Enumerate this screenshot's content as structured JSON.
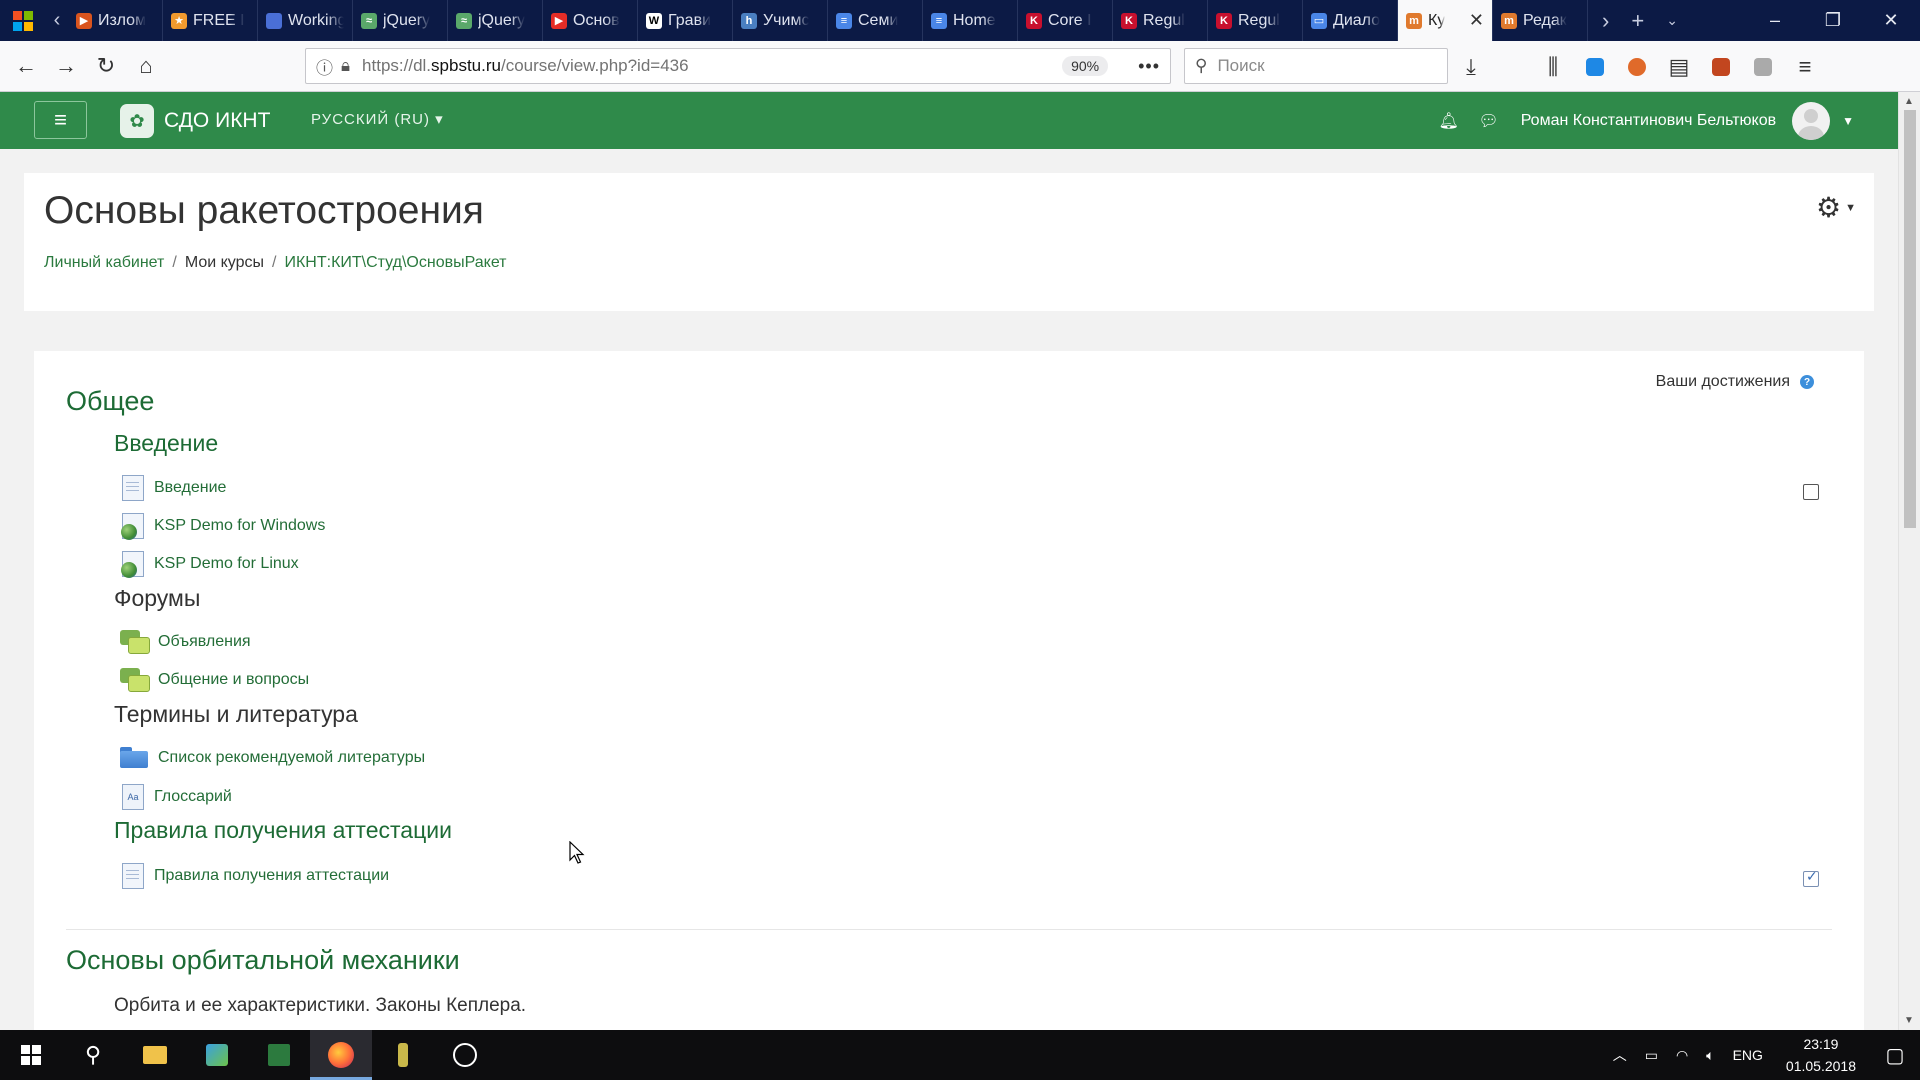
{
  "browser": {
    "tabs": [
      {
        "label": "Излом",
        "color": "#d9541e",
        "glyph": "▶"
      },
      {
        "label": "FREE I",
        "color": "#f29a2e",
        "glyph": "★"
      },
      {
        "label": "Working w",
        "color": "#4a6fd6",
        "glyph": ""
      },
      {
        "label": "jQuery",
        "color": "#5aa86a",
        "glyph": "≈"
      },
      {
        "label": "jQuery",
        "color": "#5aa86a",
        "glyph": "≈"
      },
      {
        "label": "Основ",
        "color": "#e52d27",
        "glyph": "▶"
      },
      {
        "label": "Грави",
        "color": "#ffffff",
        "glyph": "W"
      },
      {
        "label": "Учимс",
        "color": "#4a7fc1",
        "glyph": "h"
      },
      {
        "label": "Семи",
        "color": "#4a86e8",
        "glyph": "≡"
      },
      {
        "label": "Home",
        "color": "#4a86e8",
        "glyph": "≡"
      },
      {
        "label": "Core I",
        "color": "#c8102e",
        "glyph": "K"
      },
      {
        "label": "Regul",
        "color": "#c8102e",
        "glyph": "K"
      },
      {
        "label": "Regul",
        "color": "#c8102e",
        "glyph": "K"
      },
      {
        "label": "Диало",
        "color": "#4a86e8",
        "glyph": "▭"
      },
      {
        "label": "Ку",
        "color": "#e07a2e",
        "glyph": "m",
        "active": true
      },
      {
        "label": "Редак",
        "color": "#e07a2e",
        "glyph": "m"
      }
    ],
    "url_prefix": "https://dl.",
    "url_domain": "spbstu.ru",
    "url_path": "/course/view.php?id=436",
    "zoom": "90%",
    "search_placeholder": "Поиск"
  },
  "navbar": {
    "brand": "СДО ИКНТ",
    "language": "РУССКИЙ (RU)",
    "user_name": "Роман Константинович Бельтюков"
  },
  "header": {
    "title": "Основы ракетостроения",
    "breadcrumb": [
      "Личный кабинет",
      "Мои курсы",
      "ИКНТ:КИТ\\Студ\\ОсновыРакет"
    ]
  },
  "course": {
    "achievements_label": "Ваши достижения",
    "section1_title": "Общее",
    "groups": [
      {
        "title": "Введение",
        "style": "green"
      },
      {
        "title": "Форумы",
        "style": "dark"
      },
      {
        "title": "Термины и литература",
        "style": "dark"
      },
      {
        "title": "Правила получения аттестации",
        "style": "green"
      }
    ],
    "activities": [
      {
        "label": "Введение",
        "icon": "page-icon"
      },
      {
        "label": "KSP Demo for Windows",
        "icon": "url-icon"
      },
      {
        "label": "KSP Demo for Linux",
        "icon": "url-icon"
      },
      {
        "label": "Объявления",
        "icon": "forum-icon"
      },
      {
        "label": "Общение и вопросы",
        "icon": "forum-icon"
      },
      {
        "label": "Список рекомендуемой литературы",
        "icon": "folder-icon"
      },
      {
        "label": "Глоссарий",
        "icon": "glossary-icon"
      },
      {
        "label": "Правила получения аттестации",
        "icon": "page-icon"
      }
    ],
    "section2_title": "Основы орбитальной механики",
    "section2_summary": "Орбита и ее характеристики. Законы Кеплера."
  },
  "taskbar": {
    "language": "ENG",
    "time": "23:19",
    "date": "01.05.2018"
  }
}
